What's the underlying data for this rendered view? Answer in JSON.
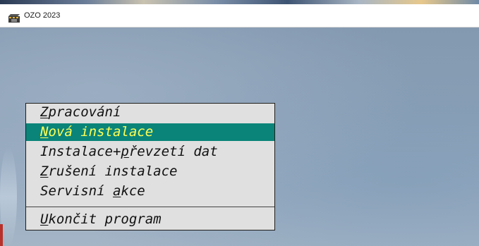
{
  "window": {
    "title": "OZO 2023",
    "icon": "film-clapper-icon"
  },
  "menu": {
    "items": [
      {
        "pre": "",
        "key": "Z",
        "post": "pracování",
        "selected": false
      },
      {
        "pre": "",
        "key": "N",
        "post": "ová instalace",
        "selected": true
      },
      {
        "pre": "Instalace+",
        "key": "p",
        "post": "řevzetí dat",
        "selected": false
      },
      {
        "pre": "",
        "key": "Z",
        "post": "rušení instalace",
        "selected": false
      },
      {
        "pre": "Servisní ",
        "key": "a",
        "post": "kce",
        "selected": false
      },
      {
        "pre": "",
        "key": "U",
        "post": "končit program",
        "selected": false
      }
    ]
  },
  "colors": {
    "selected_bg": "#0a8479",
    "selected_text": "#ffff55",
    "menu_bg": "#e0e0e0"
  }
}
